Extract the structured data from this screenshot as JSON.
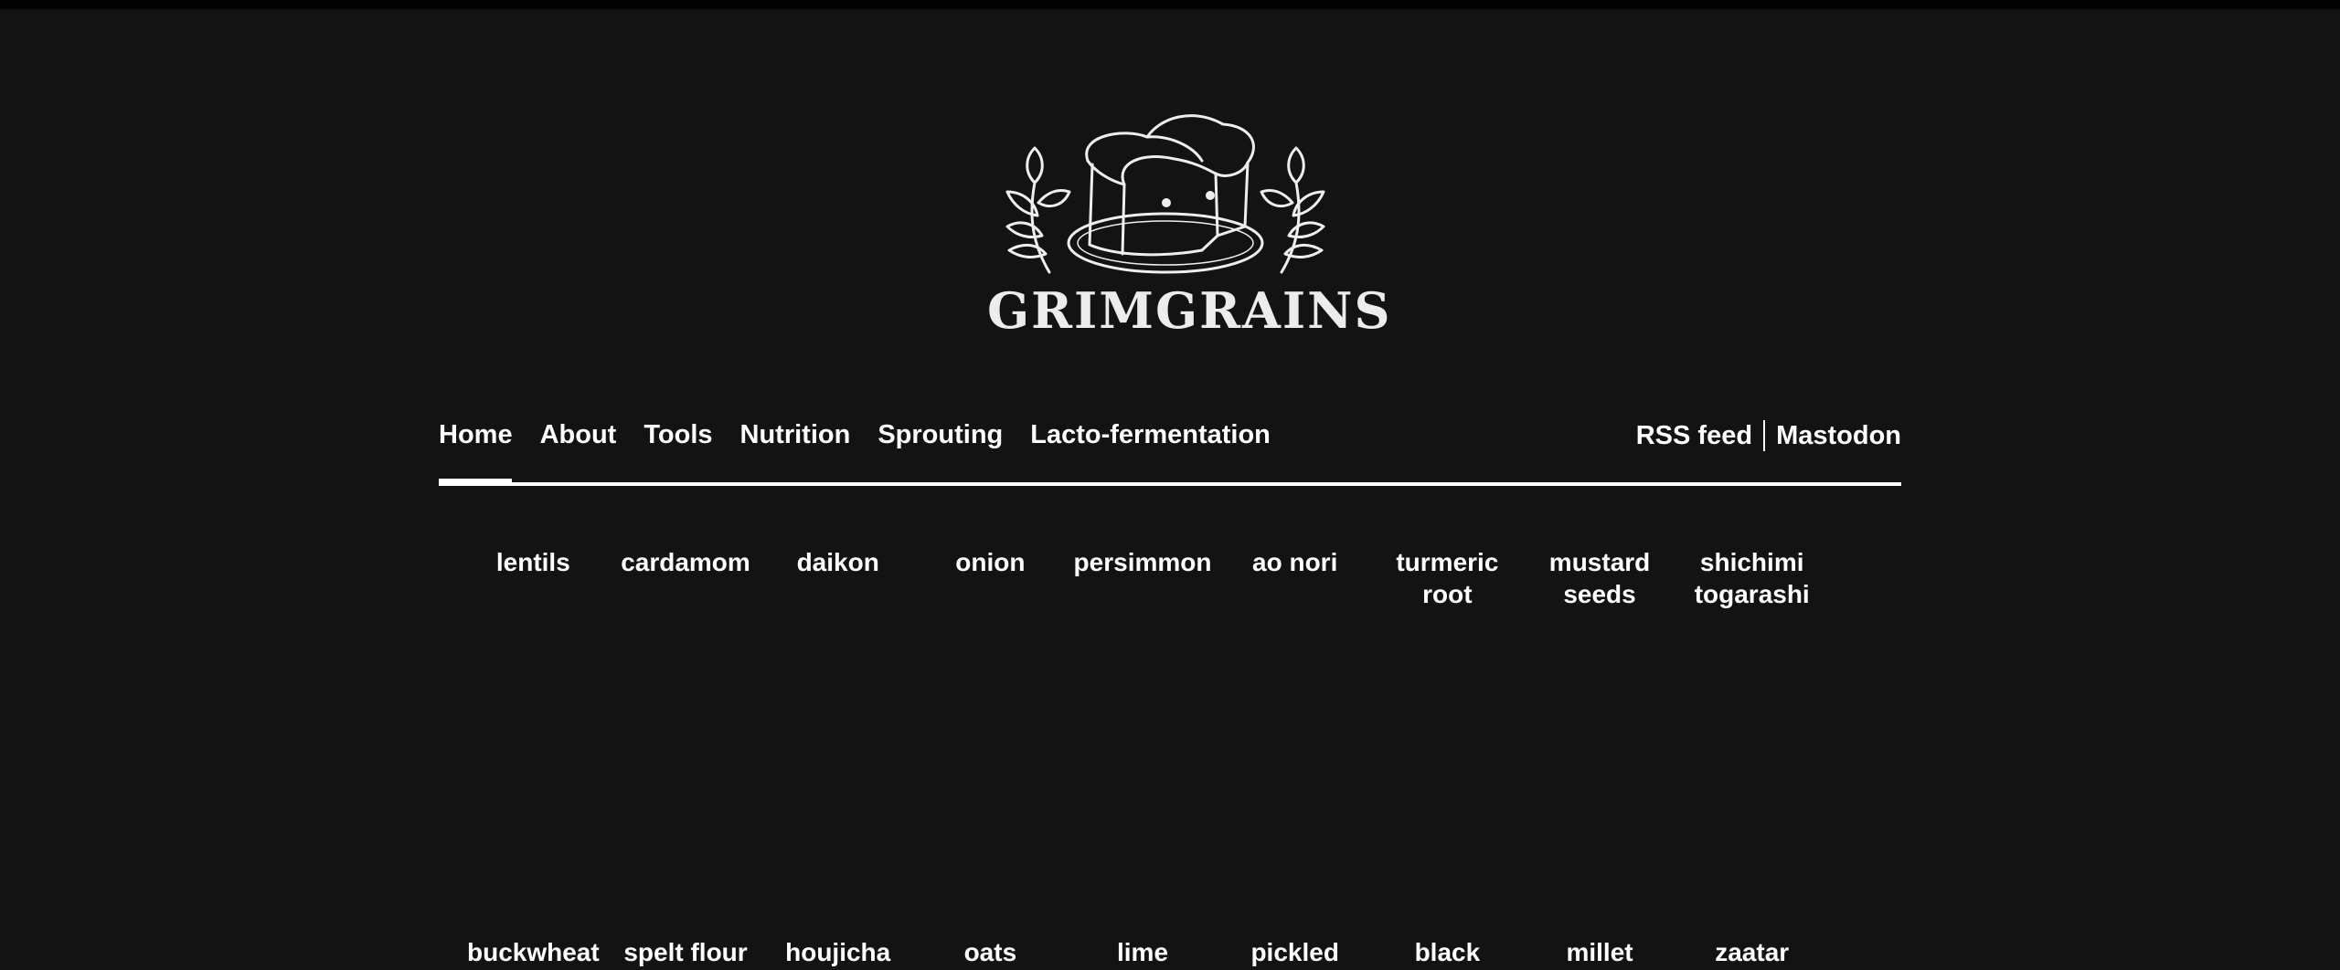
{
  "brand": {
    "name": "GRIMGRAINS",
    "logo_icon": "bread-loaf-with-laurels-icon"
  },
  "nav": {
    "left": [
      {
        "label": "Home",
        "active": true
      },
      {
        "label": "About"
      },
      {
        "label": "Tools"
      },
      {
        "label": "Nutrition"
      },
      {
        "label": "Sprouting"
      },
      {
        "label": "Lacto-fermentation"
      }
    ],
    "right": [
      {
        "label": "RSS feed"
      },
      {
        "label": "Mastodon"
      }
    ]
  },
  "ingredients_row1": [
    [
      "lentils"
    ],
    [
      "cardamom"
    ],
    [
      "daikon"
    ],
    [
      "onion"
    ],
    [
      "persimmon"
    ],
    [
      "ao nori"
    ],
    [
      "turmeric",
      "root"
    ],
    [
      "mustard",
      "seeds"
    ],
    [
      "shichimi",
      "togarashi"
    ]
  ],
  "ingredients_row2": [
    [
      "buckwheat"
    ],
    [
      "spelt flour"
    ],
    [
      "houjicha"
    ],
    [
      "oats"
    ],
    [
      "lime"
    ],
    [
      "pickled"
    ],
    [
      "black"
    ],
    [
      "millet"
    ],
    [
      "zaatar"
    ]
  ],
  "colors": {
    "background": "#131313",
    "text": "#ffffff",
    "top_bar": "#030303"
  }
}
